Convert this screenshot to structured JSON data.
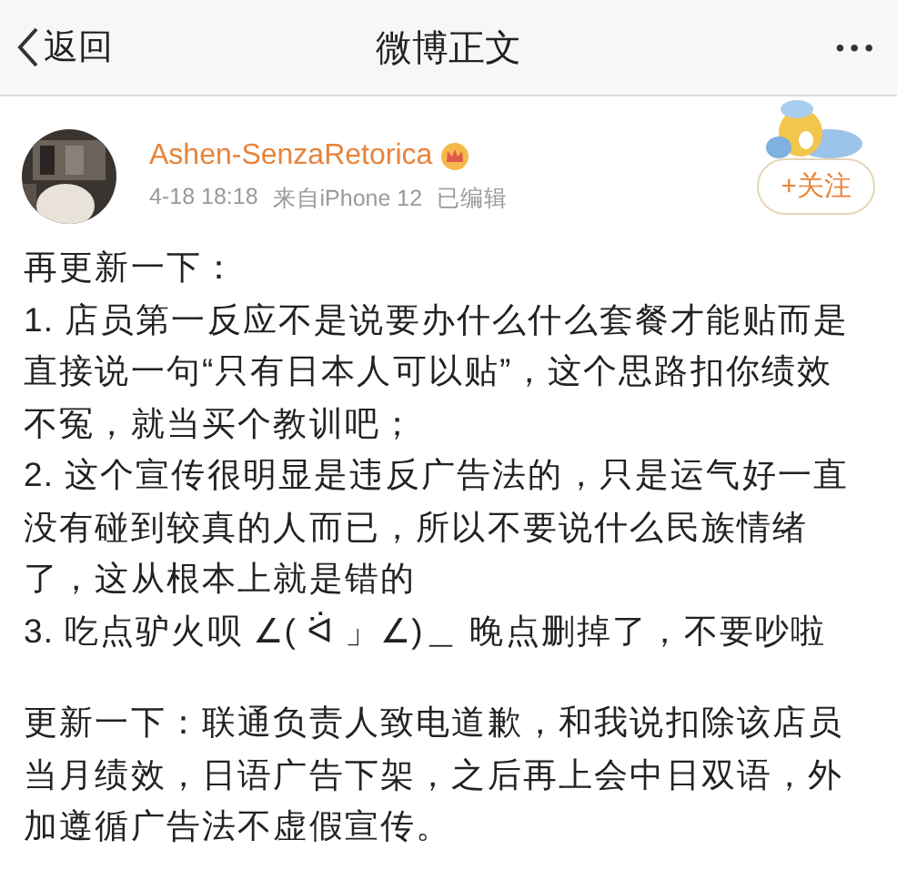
{
  "header": {
    "back_label": "返回",
    "title": "微博正文",
    "more": "•••"
  },
  "post": {
    "author": "Ashen-SenzaRetorica",
    "time": "4-18 18:18",
    "source": "来自iPhone 12",
    "edited": "已编辑",
    "follow_label": "+关注",
    "paragraphs": [
      {
        "text": "再更新一下："
      },
      {
        "text": "1. 店员第一反应不是说要办什么什么套餐才能贴而是直接说一句“只有日本人可以贴”，这个思路扣你绩效不冤，就当买个教训吧；"
      },
      {
        "text": "2. 这个宣传很明显是违反广告法的，只是运气好一直没有碰到较真的人而已，所以不要说什么民族情绪了，这从根本上就是错的"
      },
      {
        "text": "3. 吃点驴火呗 ∠( ᐛ 」∠)＿ 晚点删掉了，不要吵啦"
      },
      {
        "text": "更新一下：联通负责人致电道歉，和我说扣除该店员当月绩效，日语广告下架，之后再上会中日双语，外加遵循广告法不虚假宣传。",
        "gap": true
      }
    ]
  }
}
